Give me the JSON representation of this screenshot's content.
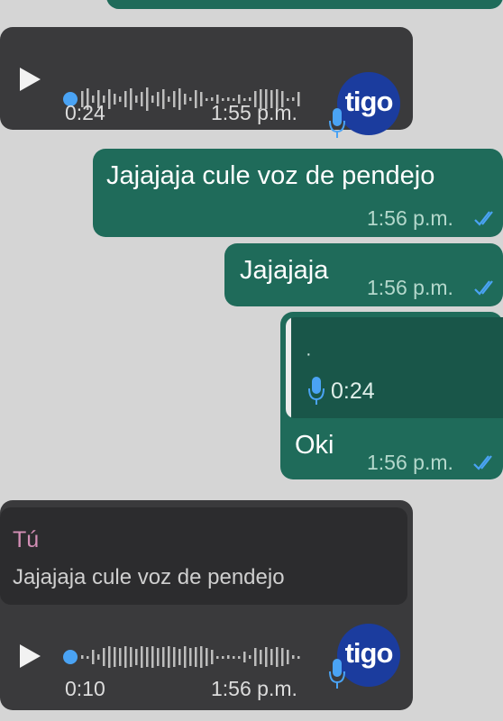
{
  "chat": {
    "msg1": {
      "duration": "0:24",
      "time": "1:55 p.m.",
      "avatar_text": "tigo"
    },
    "msg2": {
      "text": "Jajajaja cule voz de pendejo",
      "time": "1:56 p.m."
    },
    "msg3": {
      "text": "Jajajaja",
      "time": "1:56 p.m."
    },
    "msg4": {
      "quote_dot": "·",
      "quote_duration": "0:24",
      "text": "Oki",
      "time": "1:56 p.m."
    },
    "msg5": {
      "reply_author": "Tú",
      "reply_text": "Jajajaja cule voz de pendejo",
      "duration": "0:10",
      "time": "1:56 p.m.",
      "avatar_text": "tigo"
    }
  },
  "colors": {
    "background": "#d5d5d5",
    "incoming_bubble": "#3a3a3c",
    "outgoing_bubble": "#1f6b5a",
    "read_ticks": "#4aa3f4",
    "reply_author": "#d48fb6",
    "avatar": "#1b3c9e"
  }
}
